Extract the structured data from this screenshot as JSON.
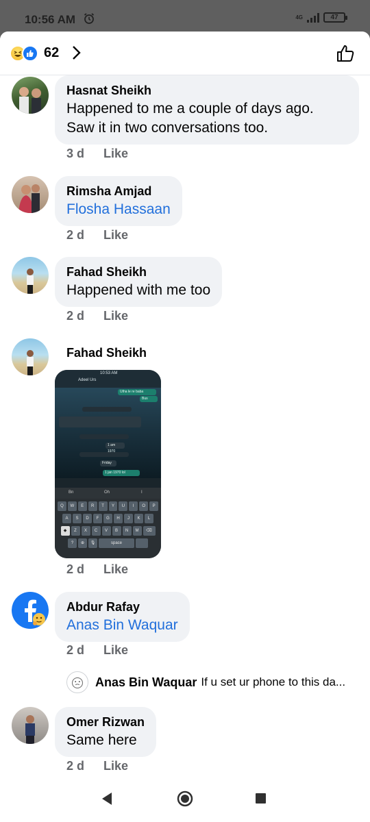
{
  "status_bar": {
    "time": "10:56 AM",
    "network": "4G",
    "battery": "47"
  },
  "header": {
    "reaction_count": "62",
    "reaction_icons": [
      "haha-icon",
      "like-icon"
    ]
  },
  "comments": [
    {
      "author": "Hasnat Sheikh",
      "text_lines": [
        "Happened to me a couple of days ago.",
        "Saw it in two conversations too."
      ],
      "time": "3 d",
      "action": "Like"
    },
    {
      "author": "Rimsha Amjad",
      "text": "Flosha Hassaan",
      "time": "2 d",
      "action": "Like"
    },
    {
      "author": "Fahad Sheikh",
      "text": "Happened with me too",
      "time": "2 d",
      "action": "Like"
    },
    {
      "author": "Fahad Sheikh",
      "attachment": {
        "title": "Adeel Urs",
        "time": "10:53 AM",
        "messages": [
          "Utha le re baba",
          "Bus",
          "Missed voice call at 12:22 AM",
          "1 am 1970",
          "Friday",
          "1 jan 1970 lol"
        ],
        "suggestions": [
          "Bn",
          "Oh",
          "I"
        ],
        "keyboard_rows": [
          "QWERTYUIOP",
          "ASDFGHJKL",
          "ZXCVBNM"
        ],
        "space_label": "space"
      },
      "time": "2 d",
      "action": "Like"
    },
    {
      "author": "Abdur Rafay",
      "text": "Anas Bin Waquar",
      "time": "2 d",
      "action": "Like",
      "reply": {
        "author": "Anas Bin Waquar",
        "text": "If u set ur phone to this da..."
      }
    },
    {
      "author": "Omer Rizwan",
      "text": "Same here",
      "time": "2 d",
      "action": "Like"
    }
  ],
  "colors": {
    "bubble": "#f0f2f5",
    "link": "#216fdb",
    "meta": "#65676b",
    "like_blue": "#1877f2"
  }
}
